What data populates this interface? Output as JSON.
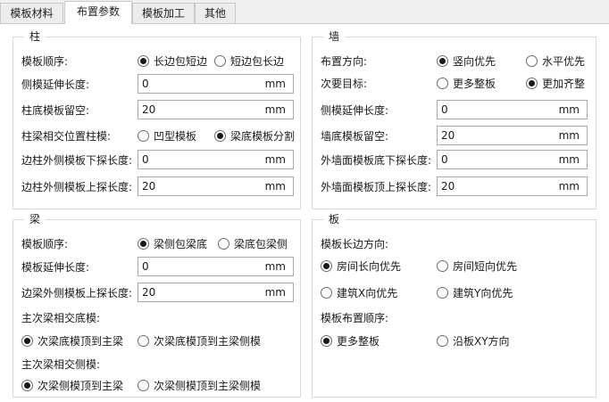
{
  "tabs": [
    "模板材料",
    "布置参数",
    "模板加工",
    "其他"
  ],
  "unit": "mm",
  "column": {
    "title": "柱",
    "order_label": "模板顺序:",
    "order_options": [
      "长边包短边",
      "短边包长边"
    ],
    "side_ext_label": "侧模延伸长度:",
    "side_ext_value": "0",
    "bottom_reserve_label": "柱底模板留空:",
    "bottom_reserve_value": "20",
    "junction_label": "柱梁相交位置柱模:",
    "junction_options": [
      "凹型模板",
      "梁底模板分割"
    ],
    "edge_down_label": "边柱外侧模板下探长度:",
    "edge_down_value": "0",
    "edge_up_label": "边柱外侧模板上探长度:",
    "edge_up_value": "20"
  },
  "wall": {
    "title": "墙",
    "direction_label": "布置方向:",
    "direction_options": [
      "竖向优先",
      "水平优先"
    ],
    "goal_label": "次要目标:",
    "goal_options": [
      "更多整板",
      "更加齐整"
    ],
    "side_ext_label": "侧模延伸长度:",
    "side_ext_value": "0",
    "bottom_reserve_label": "墙底模板留空:",
    "bottom_reserve_value": "20",
    "ext_down_label": "外墙面模板底下探长度:",
    "ext_down_value": "0",
    "ext_up_label": "外墙面模板顶上探长度:",
    "ext_up_value": "20"
  },
  "beam": {
    "title": "梁",
    "order_label": "模板顺序:",
    "order_options": [
      "梁侧包梁底",
      "梁底包梁侧"
    ],
    "ext_label": "模板延伸长度:",
    "ext_value": "0",
    "edge_up_label": "边梁外侧模板上探长度:",
    "edge_up_value": "20",
    "cross_bottom_label": "主次梁相交底模:",
    "cross_bottom_options": [
      "次梁底模顶到主梁",
      "次梁底模顶到主梁侧模"
    ],
    "cross_side_label": "主次梁相交侧模:",
    "cross_side_options": [
      "次梁侧模顶到主梁",
      "次梁侧模顶到主梁侧模"
    ]
  },
  "slab": {
    "title": "板",
    "long_dir_label": "模板长边方向:",
    "long_dir_options": [
      "房间长向优先",
      "房间短向优先",
      "建筑X向优先",
      "建筑Y向优先"
    ],
    "order_label": "模板布置顺序:",
    "order_options": [
      "更多整板",
      "沿板XY方向"
    ]
  }
}
